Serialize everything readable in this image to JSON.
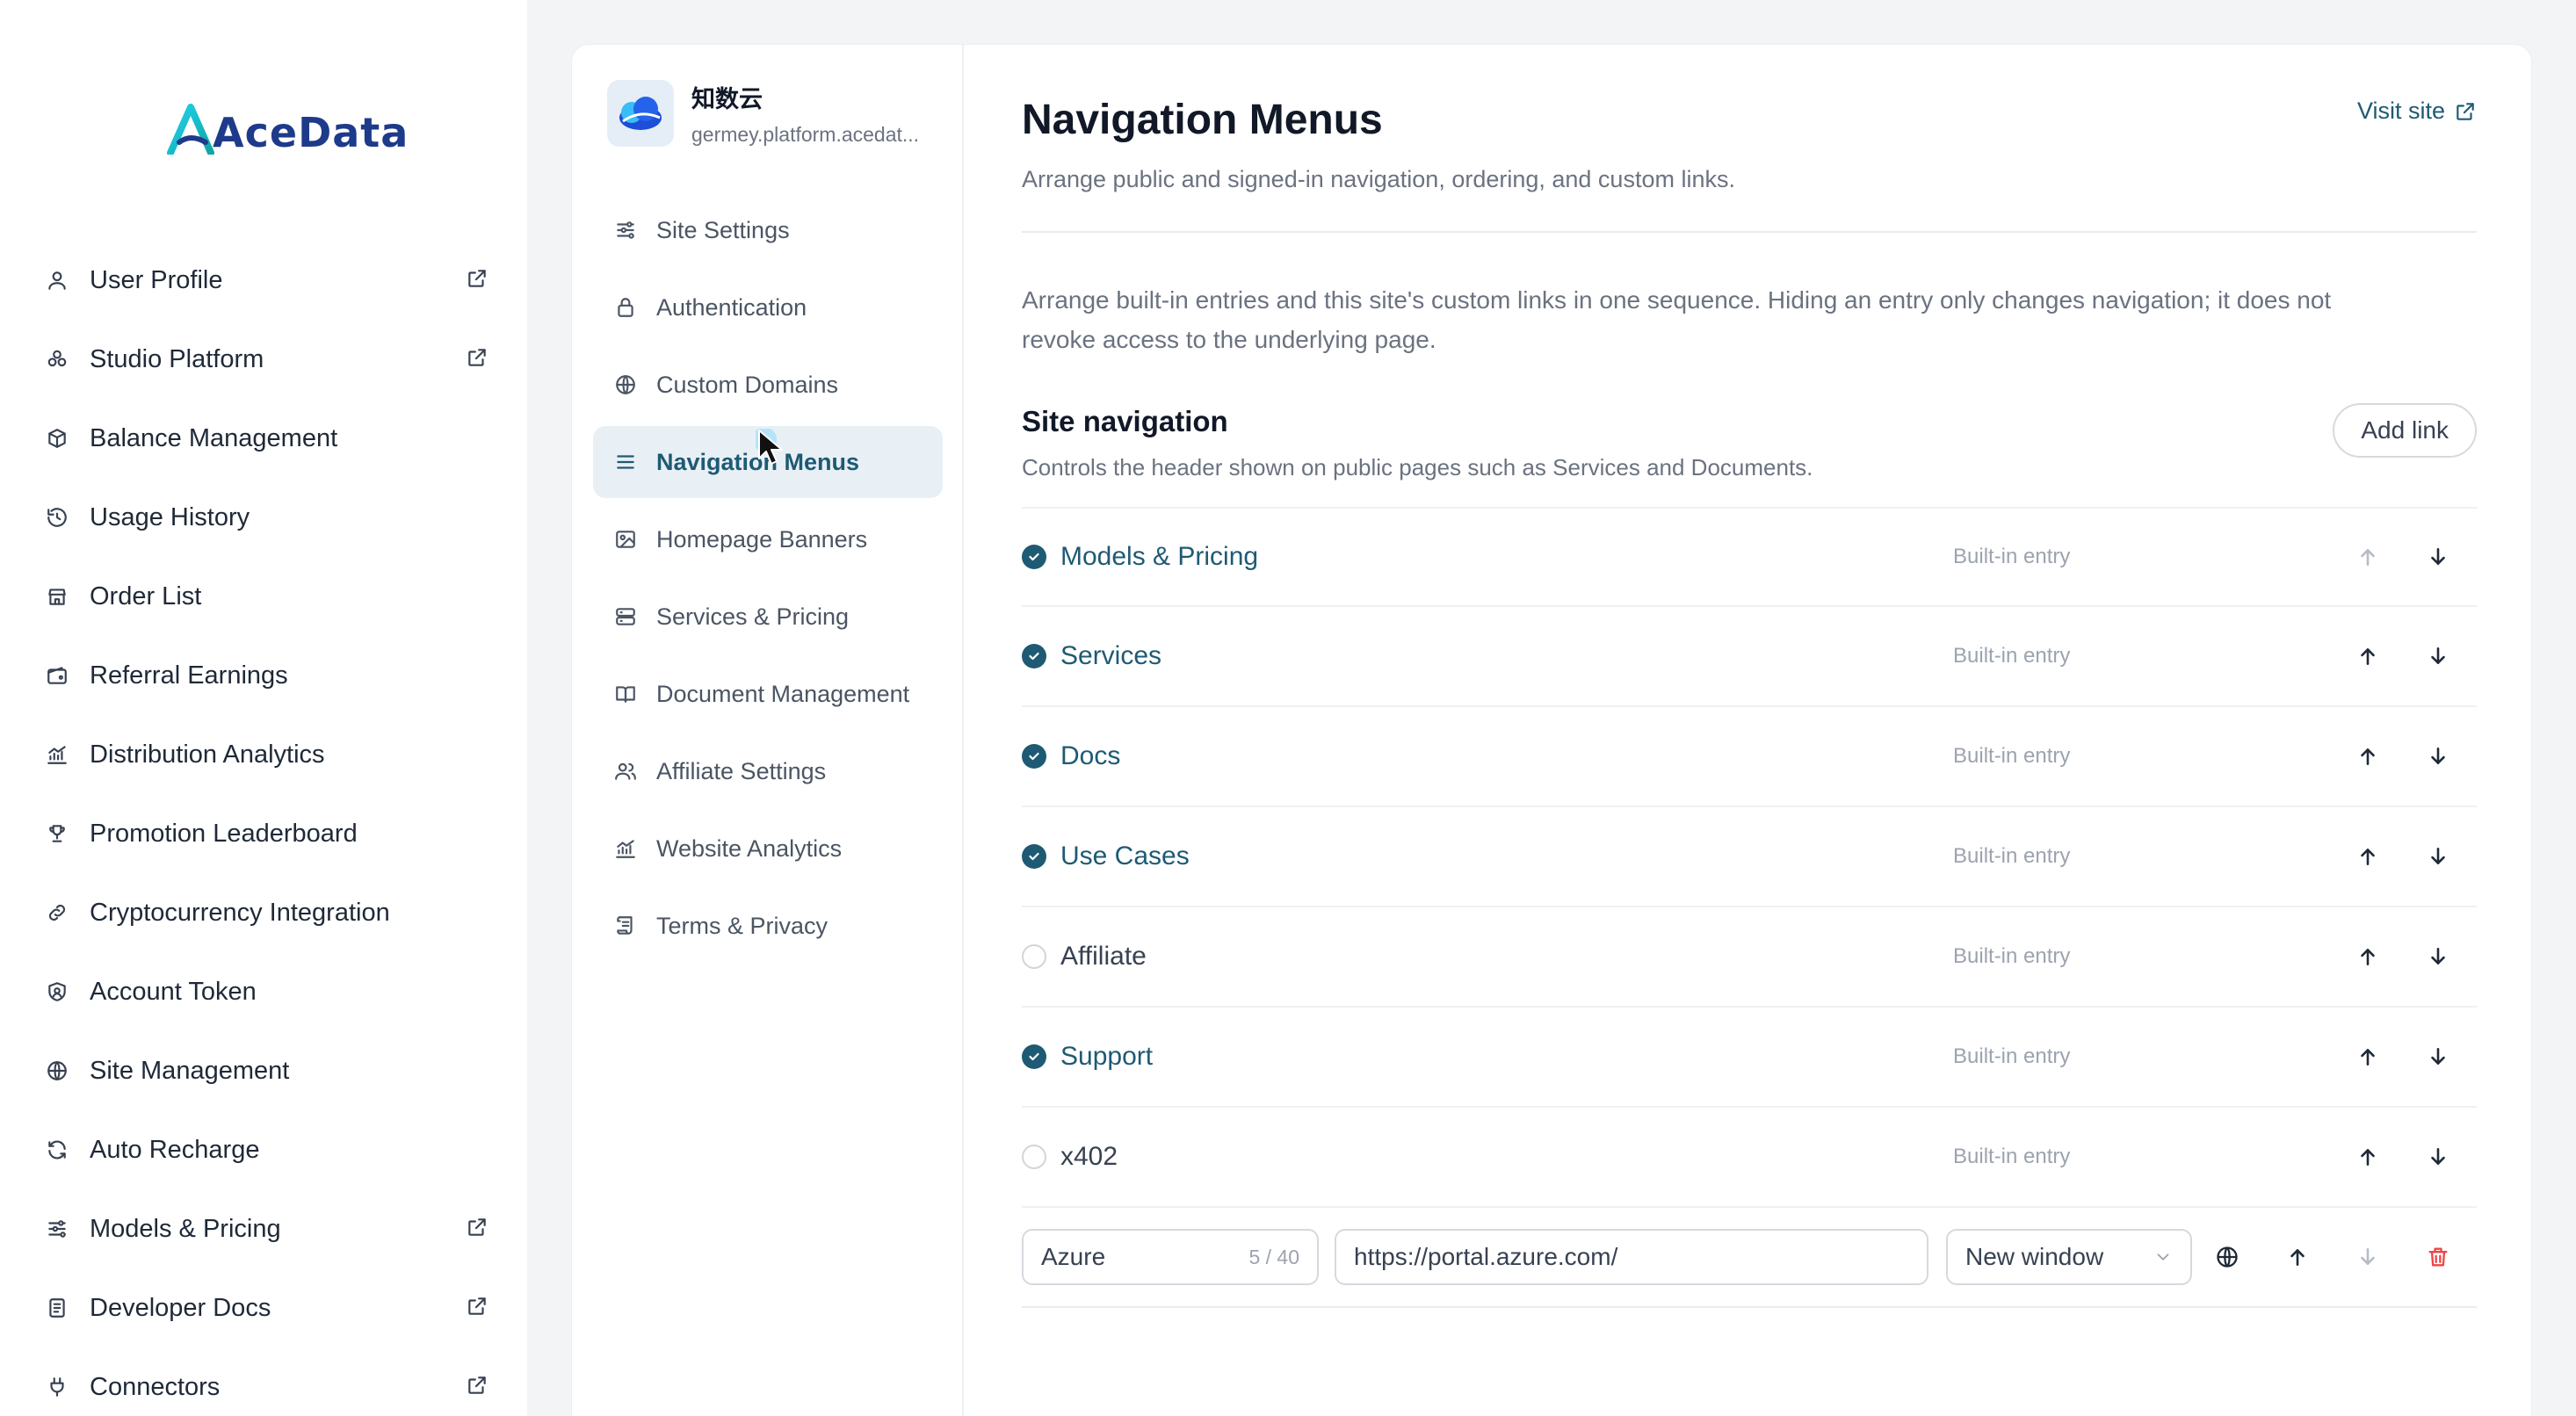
{
  "brand": {
    "name": "AceData",
    "accent": "#1e5a74",
    "logo_accent": "#22b8cf"
  },
  "sidebar": {
    "items": [
      {
        "label": "User Profile",
        "icon": "user-icon",
        "external": true
      },
      {
        "label": "Studio Platform",
        "icon": "studio-icon",
        "external": true
      },
      {
        "label": "Balance Management",
        "icon": "box-icon",
        "external": false
      },
      {
        "label": "Usage History",
        "icon": "history-icon",
        "external": false
      },
      {
        "label": "Order List",
        "icon": "store-icon",
        "external": false
      },
      {
        "label": "Referral Earnings",
        "icon": "wallet-icon",
        "external": false
      },
      {
        "label": "Distribution Analytics",
        "icon": "analytics-icon",
        "external": false
      },
      {
        "label": "Promotion Leaderboard",
        "icon": "trophy-icon",
        "external": false
      },
      {
        "label": "Cryptocurrency Integration",
        "icon": "link-icon",
        "external": false
      },
      {
        "label": "Account Token",
        "icon": "shield-icon",
        "external": false
      },
      {
        "label": "Site Management",
        "icon": "globe-icon",
        "external": false
      },
      {
        "label": "Auto Recharge",
        "icon": "refresh-icon",
        "external": false
      },
      {
        "label": "Models & Pricing",
        "icon": "sliders-icon",
        "external": true
      },
      {
        "label": "Developer Docs",
        "icon": "doc-icon",
        "external": true
      },
      {
        "label": "Connectors",
        "icon": "plug-icon",
        "external": true
      }
    ]
  },
  "site": {
    "name": "知数云",
    "domain": "germey.platform.acedat..."
  },
  "subnav": {
    "items": [
      {
        "label": "Site Settings",
        "icon": "sliders-icon",
        "active": false
      },
      {
        "label": "Authentication",
        "icon": "lock-icon",
        "active": false
      },
      {
        "label": "Custom Domains",
        "icon": "globe-icon",
        "active": false
      },
      {
        "label": "Navigation Menus",
        "icon": "menu-icon",
        "active": true
      },
      {
        "label": "Homepage Banners",
        "icon": "image-icon",
        "active": false
      },
      {
        "label": "Services & Pricing",
        "icon": "server-icon",
        "active": false
      },
      {
        "label": "Document Management",
        "icon": "book-icon",
        "active": false
      },
      {
        "label": "Affiliate Settings",
        "icon": "users-icon",
        "active": false
      },
      {
        "label": "Website Analytics",
        "icon": "analytics-icon",
        "active": false
      },
      {
        "label": "Terms & Privacy",
        "icon": "scroll-icon",
        "active": false
      }
    ]
  },
  "page": {
    "title": "Navigation Menus",
    "subtitle": "Arrange public and signed-in navigation, ordering, and custom links.",
    "visit_label": "Visit site",
    "intro_line1": "Arrange built-in entries and this site's custom links in one sequence. Hiding an entry only changes navigation; it does not",
    "intro_line2": "revoke access to the underlying page."
  },
  "section": {
    "title": "Site navigation",
    "subtitle": "Controls the header shown on public pages such as Services and Documents.",
    "add_label": "Add link"
  },
  "entries": [
    {
      "label": "Models & Pricing",
      "checked": true,
      "tag": "Built-in entry",
      "up_enabled": false,
      "down_enabled": true
    },
    {
      "label": "Services",
      "checked": true,
      "tag": "Built-in entry",
      "up_enabled": true,
      "down_enabled": true
    },
    {
      "label": "Docs",
      "checked": true,
      "tag": "Built-in entry",
      "up_enabled": true,
      "down_enabled": true
    },
    {
      "label": "Use Cases",
      "checked": true,
      "tag": "Built-in entry",
      "up_enabled": true,
      "down_enabled": true
    },
    {
      "label": "Affiliate",
      "checked": false,
      "tag": "Built-in entry",
      "up_enabled": true,
      "down_enabled": true
    },
    {
      "label": "Support",
      "checked": true,
      "tag": "Built-in entry",
      "up_enabled": true,
      "down_enabled": true
    },
    {
      "label": "x402",
      "checked": false,
      "tag": "Built-in entry",
      "up_enabled": true,
      "down_enabled": true
    }
  ],
  "custom_link": {
    "name": "Azure",
    "count": "5 / 40",
    "url": "https://portal.azure.com/",
    "target": "New window",
    "up_enabled": true,
    "down_enabled": false
  }
}
